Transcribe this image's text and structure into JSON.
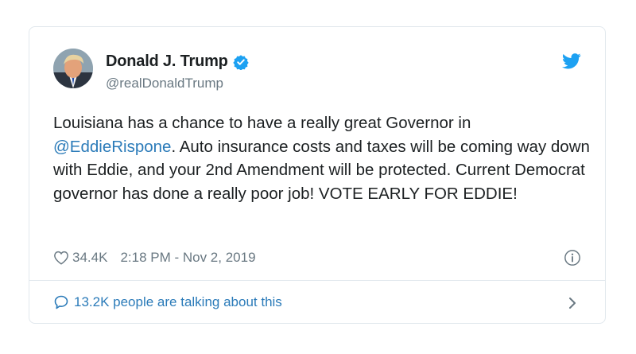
{
  "author": {
    "name": "Donald J. Trump",
    "handle": "@realDonaldTrump",
    "verified": true,
    "avatar_icon": "profile-photo"
  },
  "tweet": {
    "text_before": "Louisiana has a chance to have a really great Governor in ",
    "mention": "@EddieRispone",
    "text_after": ". Auto insurance costs and taxes will be coming way down with Eddie, and your 2nd Amendment will be protected. Current Democrat governor has done a really poor job! VOTE EARLY FOR EDDIE!"
  },
  "meta": {
    "likes": "34.4K",
    "timestamp": "2:18 PM - Nov 2, 2019"
  },
  "conversation": {
    "label": "13.2K people are talking about this"
  },
  "colors": {
    "link": "#2b7bb9",
    "twitter_blue": "#1da1f2",
    "muted": "#697882",
    "border": "#e1e8ed"
  },
  "icons": [
    "verified-badge-icon",
    "twitter-bird-icon",
    "heart-icon",
    "info-icon",
    "speech-bubble-icon",
    "chevron-right-icon"
  ]
}
